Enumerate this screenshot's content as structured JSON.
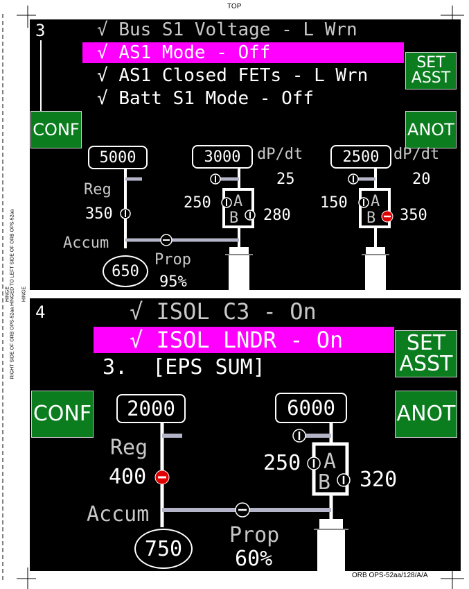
{
  "page": {
    "top_label": "TOP",
    "side_label": "RIGHT SIDE OF ORB OPS-52aa HINGED TO LEFT SIDE OF ORB OPS-52aa",
    "hinge_label_1": "HINGE",
    "hinge_label_2": "HINGE",
    "footer_id": "ORB OPS-52aa/128/A/A"
  },
  "panel3": {
    "number": "3",
    "checklist": [
      {
        "check": "√",
        "text": "Bus S1 Voltage - L Wrn",
        "highlighted": false
      },
      {
        "check": "√",
        "text": "AS1 Mode - Off",
        "highlighted": true
      },
      {
        "check": "√",
        "text": "AS1 Closed FETs - L Wrn",
        "highlighted": false
      },
      {
        "check": "√",
        "text": "Batt S1 Mode - Off",
        "highlighted": false
      }
    ],
    "set_asst": {
      "line1": "SET",
      "line2": "ASST"
    },
    "conf": "CONF",
    "anot": "ANOT",
    "diagram": {
      "reg_tank_value": "5000",
      "reg_label": "Reg",
      "reg_value": "350",
      "accum_label": "Accum",
      "accum_value": "650",
      "prop_label": "Prop",
      "prop_value": "95%",
      "tank1": {
        "value": "3000",
        "rate_label": "dP/dt",
        "rate_value": "25",
        "a_value": "250",
        "b_value": "280",
        "a_label": "A",
        "b_label": "B"
      },
      "tank2": {
        "value": "2500",
        "rate_label": "dP/dt",
        "rate_value": "20",
        "a_value": "150",
        "b_value": "350",
        "a_label": "A",
        "b_label": "B"
      }
    }
  },
  "panel4": {
    "number": "4",
    "checklist": [
      {
        "check": "√",
        "text": "ISOL C3 - On",
        "highlighted": false
      },
      {
        "check": "√",
        "text": "ISOL LNDR - On",
        "highlighted": true
      }
    ],
    "step": "3.  [EPS SUM]",
    "set_asst": {
      "line1": "SET",
      "line2": "ASST"
    },
    "conf": "CONF",
    "anot": "ANOT",
    "diagram": {
      "reg_tank_value": "2000",
      "reg_label": "Reg",
      "reg_value": "400",
      "accum_label": "Accum",
      "accum_value": "750",
      "prop_label": "Prop",
      "prop_value": "60%",
      "tank1": {
        "value": "6000",
        "a_value": "250",
        "b_value": "320",
        "a_label": "A",
        "b_label": "B"
      }
    }
  },
  "colors": {
    "highlight": "#ff00ff",
    "button": "#0b7d1f",
    "alarm": "#e00000",
    "line": "#b4b4c8"
  }
}
